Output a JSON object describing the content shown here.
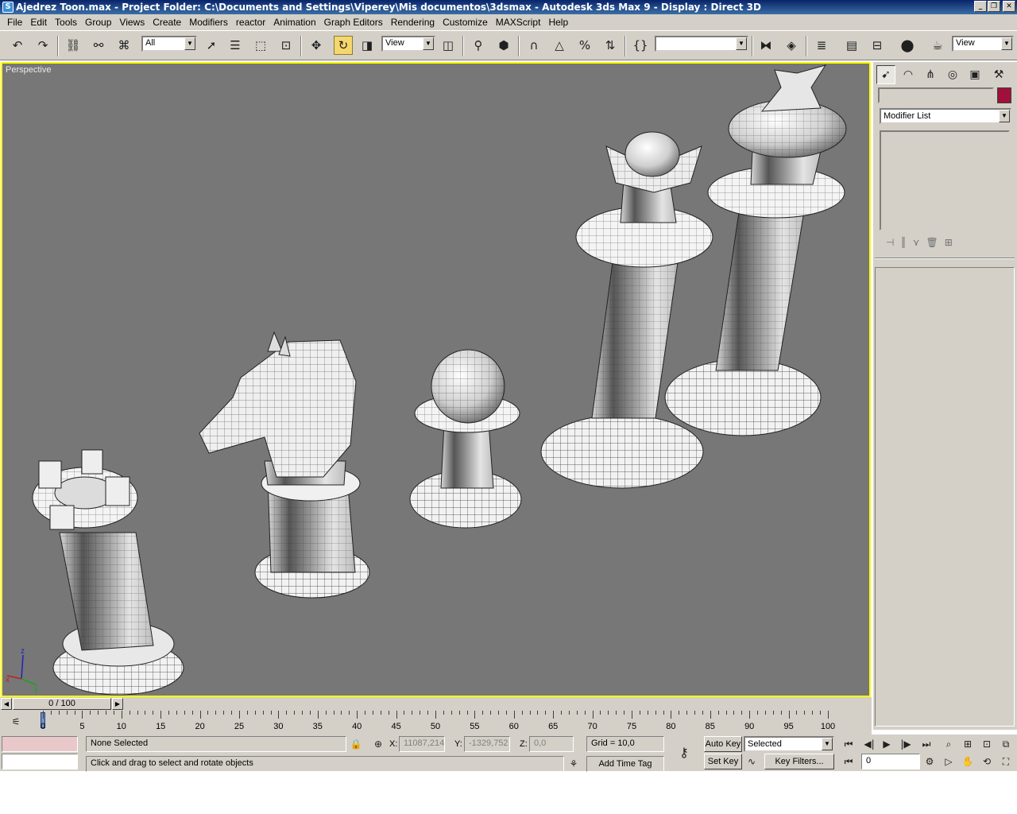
{
  "titlebar": {
    "text": "Ajedrez Toon.max    - Project Folder: C:\\Documents and Settings\\Viperey\\Mis documentos\\3dsmax    - Autodesk 3ds Max 9      - Display : Direct 3D"
  },
  "menu": [
    "File",
    "Edit",
    "Tools",
    "Group",
    "Views",
    "Create",
    "Modifiers",
    "reactor",
    "Animation",
    "Graph Editors",
    "Rendering",
    "Customize",
    "MAXScript",
    "Help"
  ],
  "toolbar": {
    "selection_filter": "All",
    "ref_coord": "View",
    "named_selection": "",
    "view_dropdown": "View"
  },
  "viewport": {
    "label": "Perspective"
  },
  "command_panel": {
    "modifier_list": "Modifier List",
    "color": "#a0103a"
  },
  "timeline": {
    "slider_text": "0 / 100",
    "ticks": [
      "0",
      "5",
      "10",
      "15",
      "20",
      "25",
      "30",
      "35",
      "40",
      "45",
      "50",
      "55",
      "60",
      "65",
      "70",
      "75",
      "80",
      "85",
      "90",
      "95",
      "100"
    ]
  },
  "status": {
    "selection": "None Selected",
    "prompt": "Click and drag to select and rotate objects",
    "x_label": "X:",
    "x_value": "11087,214",
    "y_label": "Y:",
    "y_value": "-1329,752",
    "z_label": "Z:",
    "z_value": "0,0",
    "grid": "Grid = 10,0",
    "add_time_tag": "Add Time Tag",
    "auto_key": "Auto Key",
    "key_mode": "Selected",
    "set_key": "Set Key",
    "key_filters": "Key Filters...",
    "frame": "0"
  }
}
